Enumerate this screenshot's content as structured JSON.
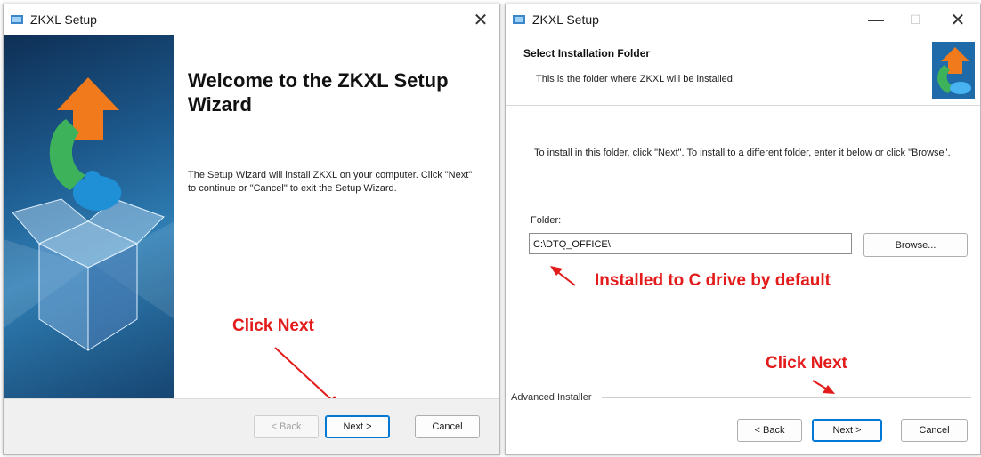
{
  "colors": {
    "annotation_red": "#e31b1b",
    "accent_blue": "#0078d4"
  },
  "left_window": {
    "title": "ZKXL Setup",
    "close_glyph": "✕",
    "welcome_title": "Welcome to the ZKXL Setup Wizard",
    "welcome_body": "The Setup Wizard will install ZKXL on your computer.  Click \"Next\" to continue or \"Cancel\" to exit the Setup Wizard.",
    "annotation": "Click Next",
    "buttons": {
      "back": "< Back",
      "next": "Next >",
      "cancel": "Cancel"
    }
  },
  "right_window": {
    "title": "ZKXL Setup",
    "minimize_glyph": "—",
    "maximize_glyph": "☐",
    "close_glyph": "✕",
    "header_title": "Select Installation Folder",
    "header_subtitle": "This is the folder where ZKXL will be installed.",
    "instructions": "To install in this folder, click \"Next\". To install to a different folder, enter it below or click \"Browse\".",
    "folder_label": "Folder:",
    "folder_value": "C:\\DTQ_OFFICE\\",
    "browse": "Browse...",
    "annotation_folder": "Installed to C drive by default",
    "annotation_next": "Click Next",
    "footer_label": "Advanced Installer",
    "buttons": {
      "back": "< Back",
      "next": "Next >",
      "cancel": "Cancel"
    }
  },
  "icons": [
    "setup-app-icon",
    "puzzle-box-graphic",
    "puzzle-logo-icon",
    "annotation-arrow-icon"
  ]
}
